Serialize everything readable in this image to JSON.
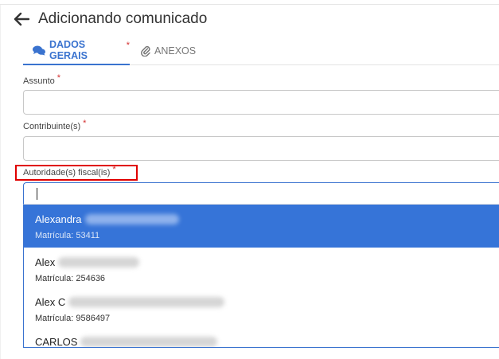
{
  "header": {
    "title": "Adicionando comunicado",
    "back_icon": "arrow-left-icon"
  },
  "tabs": [
    {
      "label": "DADOS GERAIS",
      "required_mark": "*",
      "icon": "comments-icon",
      "active": true
    },
    {
      "label": "ANEXOS",
      "icon": "paperclip-icon",
      "active": false
    }
  ],
  "form": {
    "assunto": {
      "label": "Assunto",
      "required_mark": "*",
      "value": ""
    },
    "contribuintes": {
      "label": "Contribuinte(s)",
      "required_mark": "*",
      "value": ""
    },
    "autoridades": {
      "label": "Autoridade(s) fiscal(is)",
      "required_mark": "*",
      "value": ""
    }
  },
  "dropdown": {
    "options": [
      {
        "name": "Alexandra",
        "matricula": "Matrícula: 53411",
        "selected": true
      },
      {
        "name": "Alex",
        "matricula": "Matrícula: 254636",
        "selected": false
      },
      {
        "name": "Alex C",
        "matricula": "Matrícula: 9586497",
        "selected": false
      },
      {
        "name": "CARLOS",
        "matricula": "",
        "selected": false
      }
    ]
  },
  "colors": {
    "accent": "#3a73cf",
    "selected_bg": "#3674d8",
    "required": "#d32f2f",
    "highlight": "#e00000"
  }
}
